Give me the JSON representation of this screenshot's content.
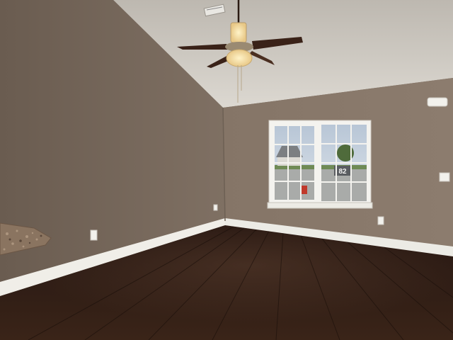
{
  "scene": {
    "description_label": "",
    "objects": {
      "ceiling_fan": "ceiling-fan",
      "window": "double-hung-window",
      "sign_number": "82",
      "floor": "dark-wood-floor",
      "counter": "granite-countertop"
    }
  },
  "colors": {
    "wall_left": "#7b6c5f",
    "wall_right": "#8a7a6c",
    "ceiling": "#d6d2cb",
    "floor": "#2d1b14",
    "trim": "#f2f0eb",
    "fan_blade": "#3a2218",
    "glass_sky": "#c9d3de"
  }
}
